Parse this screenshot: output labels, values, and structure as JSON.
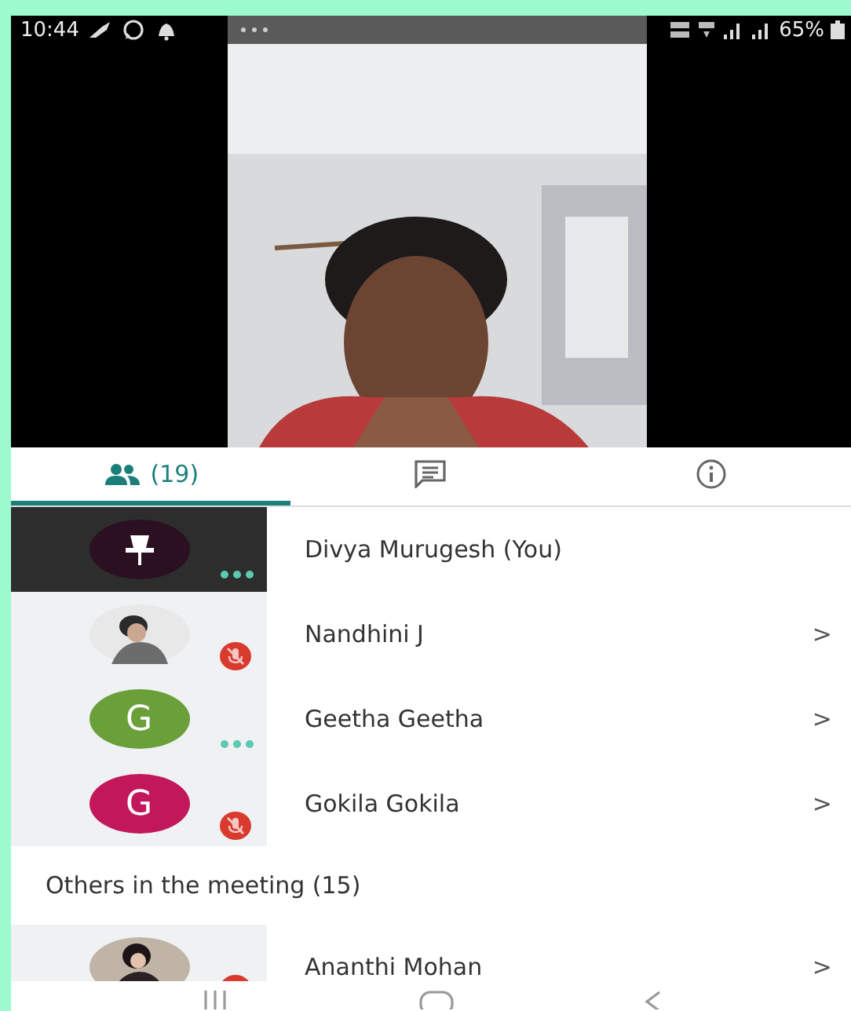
{
  "status_bar": {
    "time": "10:44",
    "battery": "65%"
  },
  "tabs": [
    {
      "kind": "people",
      "label": "(19)",
      "selected": true
    },
    {
      "kind": "chat",
      "selected": false
    },
    {
      "kind": "info",
      "selected": false
    }
  ],
  "participants": [
    {
      "name": "Divya Murugesh (You)",
      "avatar": {
        "kind": "pin"
      },
      "pinned": true,
      "muted": false
    },
    {
      "name": "Nandhini J",
      "pinned": false,
      "muted": true,
      "chevron": ">"
    },
    {
      "name": "Geetha Geetha",
      "avatar": {
        "kind": "letter",
        "letter": "G",
        "color": "#6a9f3a"
      },
      "pinned": false,
      "muted": false,
      "chevron": ">"
    },
    {
      "name": "Gokila Gokila",
      "avatar": {
        "kind": "letter",
        "letter": "G",
        "color": "#c2185b"
      },
      "pinned": false,
      "muted": true,
      "chevron": ">"
    }
  ],
  "others": {
    "heading": "Others in the meeting (15)",
    "participants": [
      {
        "name": "Ananthi Mohan",
        "pinned": false,
        "muted": true,
        "chevron": ">"
      }
    ]
  }
}
